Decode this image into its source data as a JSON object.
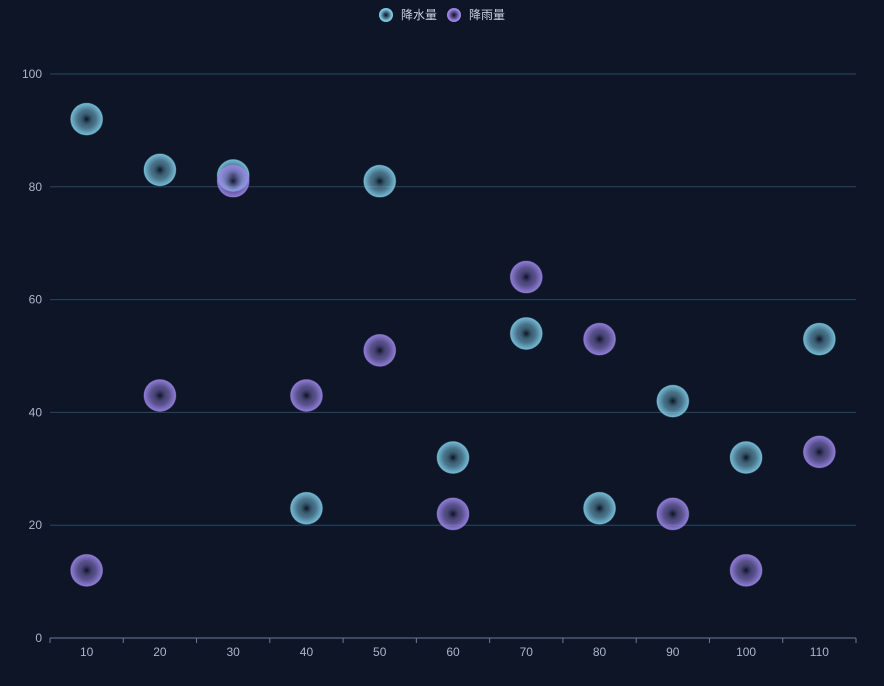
{
  "chart_data": {
    "type": "scatter",
    "title": "",
    "xlabel": "",
    "ylabel": "",
    "x": [
      10,
      20,
      30,
      40,
      50,
      60,
      70,
      80,
      90,
      100,
      110
    ],
    "x_tick_labels": [
      "10",
      "20",
      "30",
      "40",
      "50",
      "60",
      "70",
      "80",
      "90",
      "100",
      "110"
    ],
    "y_ticks": [
      0,
      20,
      40,
      60,
      80,
      100
    ],
    "y_tick_labels": [
      "0",
      "20",
      "40",
      "60",
      "80",
      "100"
    ],
    "ylim": [
      0,
      100
    ],
    "grid": true,
    "legend_position": "top-center",
    "series": [
      {
        "name": "降水量",
        "color": "#7ec8e3",
        "values": [
          92,
          83,
          82,
          23,
          81,
          32,
          54,
          23,
          42,
          32,
          53
        ]
      },
      {
        "name": "降雨量",
        "color": "#9b86e6",
        "values": [
          12,
          43,
          81,
          43,
          51,
          22,
          64,
          53,
          22,
          12,
          33
        ]
      }
    ]
  },
  "colors": {
    "background": "#0d1526",
    "grid": "#2a4660",
    "axis": "#6b7c93",
    "text": "#aab6c8"
  }
}
